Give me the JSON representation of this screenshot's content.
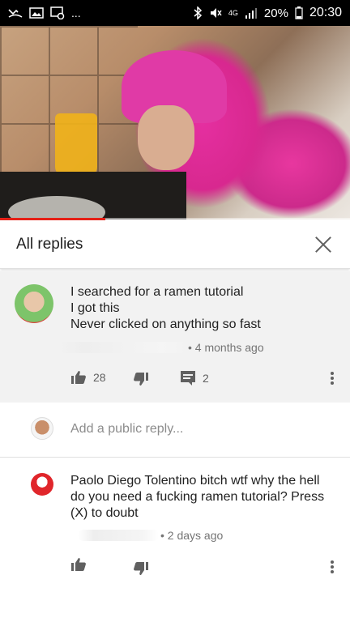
{
  "status_bar": {
    "left_icons": [
      "missed-call-icon",
      "image-icon",
      "gallery-icon",
      "more-notifications-icon"
    ],
    "overflow": "...",
    "right_icons": [
      "bluetooth-icon",
      "mute-icon",
      "network-4g-icon",
      "signal-icon",
      "battery-icon"
    ],
    "network": "4G",
    "battery_percent": "20%",
    "time": "20:30"
  },
  "video": {
    "progress_fraction": 0.3
  },
  "replies_panel": {
    "title": "All replies",
    "close_icon": "close-icon"
  },
  "parent_comment": {
    "lines": [
      "I searched for a ramen tutorial",
      "I got this",
      "Never clicked on anything so fast"
    ],
    "time_ago": "• 4 months ago",
    "like_count": "28",
    "reply_count": "2"
  },
  "add_reply": {
    "placeholder": "Add a public reply..."
  },
  "reply": {
    "lines": [
      "Paolo Diego Tolentino bitch wtf why the hell",
      "do you need a fucking ramen tutorial? Press",
      "(X) to doubt"
    ],
    "time_ago": "• 2 days ago"
  },
  "colors": {
    "accent_red": "#e62117",
    "parent_bg": "#f2f2f2",
    "icon_gray": "#606060"
  }
}
